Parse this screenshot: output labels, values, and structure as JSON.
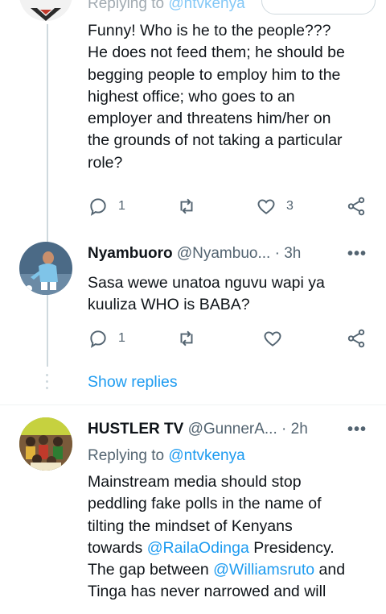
{
  "reply1": {
    "replying_prefix": "Replying to",
    "replying_handle": "@ntvkenya",
    "body_lines": [
      "Funny! Who is he to the people???",
      "He does not feed them; he should be",
      "begging people to employ him to the",
      "highest office; who goes to an",
      "employer and threatens him/her on",
      "the grounds of not taking a particular",
      "role?"
    ],
    "reply_count": "1",
    "like_count": "3"
  },
  "reply2": {
    "name": "Nyambuoro",
    "handle": "@Nyambuo...",
    "time": "· 3h",
    "more": "•••",
    "body_lines": [
      "Sasa wewe unatoa nguvu wapi ya",
      "kuuliza WHO is BABA?"
    ],
    "reply_count": "1"
  },
  "show_replies": "Show replies",
  "tweet3": {
    "name": "HUSTLER TV",
    "handle": "@GunnerA...",
    "time": "· 2h",
    "more": "•••",
    "replying_prefix": "Replying to",
    "replying_handle": "@ntvkenya",
    "line1": "Mainstream media  should stop",
    "line2": "peddling fake polls in the name of",
    "line3": "tilting the mindset of Kenyans",
    "line4_pre": "towards ",
    "line4_mention": "@RailaOdinga",
    "line4_post": " Presidency.",
    "line5_pre": "The gap between ",
    "line5_mention": "@Williamsruto",
    "line5_post": " and",
    "line6": "Tinga has never narrowed and will"
  },
  "colors": {
    "accent": "#1d9bf0",
    "secondary_text": "#536471",
    "primary_text": "#0f1419",
    "line": "#cfd9de"
  }
}
